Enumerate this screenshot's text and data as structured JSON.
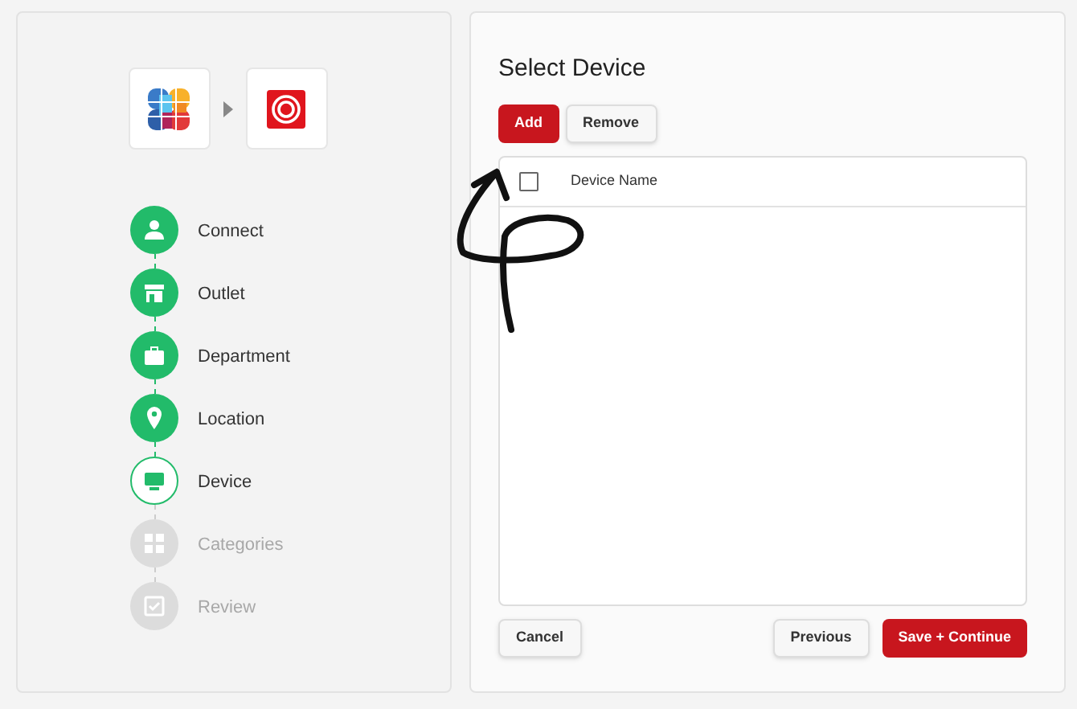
{
  "steps": [
    {
      "label": "Connect",
      "completed": true,
      "selected": false
    },
    {
      "label": "Outlet",
      "completed": true,
      "selected": false
    },
    {
      "label": "Department",
      "completed": true,
      "selected": false
    },
    {
      "label": "Location",
      "completed": true,
      "selected": false
    },
    {
      "label": "Device",
      "completed": false,
      "selected": true
    },
    {
      "label": "Categories",
      "completed": false,
      "selected": false
    },
    {
      "label": "Review",
      "completed": false,
      "selected": false
    }
  ],
  "panel": {
    "title": "Select Device",
    "toolbar": [
      {
        "label": "Add",
        "kind": "primary"
      },
      {
        "label": "Remove",
        "kind": "secondary"
      }
    ],
    "table": {
      "header_checked": false,
      "columns": [
        "Device Name"
      ]
    },
    "footer_left": [
      {
        "label": "Cancel",
        "kind": "secondary"
      }
    ],
    "footer_right": [
      {
        "label": "Previous",
        "kind": "secondary"
      },
      {
        "label": "Save + Continue",
        "kind": "primary"
      }
    ]
  }
}
